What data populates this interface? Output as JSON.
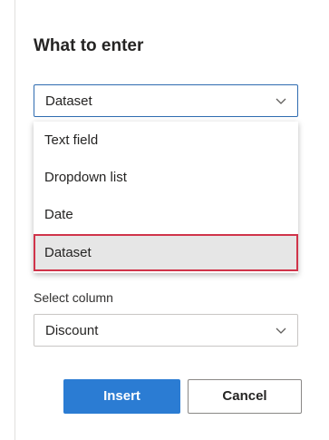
{
  "dialog": {
    "title": "What to enter",
    "type_select": {
      "value": "Dataset",
      "options": [
        "Text field",
        "Dropdown list",
        "Date",
        "Dataset"
      ],
      "selected_index": 3
    },
    "column_select": {
      "label": "Select column",
      "value": "Discount"
    },
    "buttons": {
      "insert": "Insert",
      "cancel": "Cancel"
    },
    "colors": {
      "accent": "#2b7cd3",
      "highlight_border": "#d0344a",
      "selected_bg": "#e6e6e6"
    }
  }
}
